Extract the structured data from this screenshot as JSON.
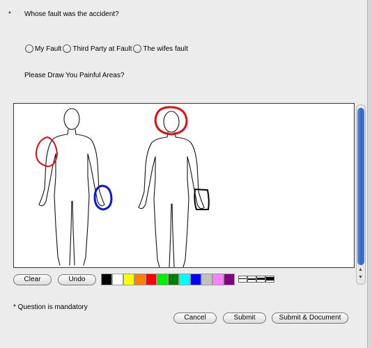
{
  "question1": {
    "marker": "*",
    "text": "Whose fault was the accident?",
    "options": [
      "My Fault",
      "Third Party at Fault",
      "The wifes fault"
    ]
  },
  "question2": {
    "text": "Please Draw You Painful Areas?"
  },
  "drawing_tools": {
    "clear_label": "Clear",
    "undo_label": "Undo",
    "palette": [
      "#000000",
      "#ffffff",
      "#ffff00",
      "#ff8000",
      "#ff0000",
      "#00ee00",
      "#008000",
      "#00ffff",
      "#0000ff",
      "#c0c0c0",
      "#ff80ff",
      "#800080"
    ]
  },
  "footer": {
    "mandatory_note": "* Question is mandatory",
    "cancel_label": "Cancel",
    "submit_label": "Submit",
    "submit_document_label": "Submit & Document"
  }
}
